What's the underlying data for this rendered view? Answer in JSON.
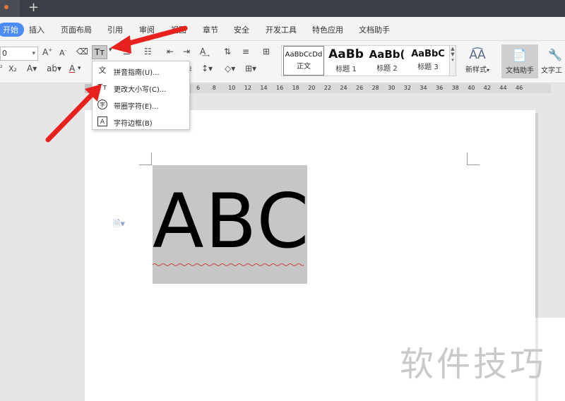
{
  "tabbar": {
    "new_tab_icon": "plus-icon",
    "new_tab_label": "+"
  },
  "menu": {
    "items": [
      "开始",
      "插入",
      "页面布局",
      "引用",
      "审阅",
      "视图",
      "章节",
      "安全",
      "开发工具",
      "特色应用",
      "文档助手"
    ],
    "active_index": 0,
    "active_color": "#4c8cf5"
  },
  "ribbon": {
    "font_size_value": "0",
    "icons": [
      "increase-font-icon",
      "decrease-font-icon",
      "clear-format-icon",
      "change-case-icon",
      "bullet-list-icon",
      "numbered-list-icon",
      "indent-icon",
      "outdent-icon",
      "text-direction-icon",
      "sort-icon",
      "line-spacing-icon",
      "table-icon",
      "superscript-icon",
      "subscript-icon",
      "font-color-icon",
      "highlight-icon",
      "shading-icon",
      "border-icon"
    ],
    "styles": [
      {
        "sample": "AaBbCcDd",
        "name": "正文"
      },
      {
        "sample": "AaBb",
        "name": "标题 1"
      },
      {
        "sample": "AaBb(",
        "name": "标题 2"
      },
      {
        "sample": "AaBbC",
        "name": "标题 3"
      }
    ],
    "new_style_label": "新样式",
    "doc_assistant_label": "文档助手",
    "text_tools_label": "文字工"
  },
  "ruler": {
    "numbers": [
      "6",
      "8",
      "10",
      "12",
      "14",
      "16",
      "18",
      "20",
      "22",
      "24",
      "26",
      "28",
      "30",
      "32",
      "34",
      "36",
      "38",
      "40",
      "42",
      "44",
      "46"
    ]
  },
  "document": {
    "text": "ABC"
  },
  "dropdown": {
    "items": [
      {
        "icon": "pinyin-guide-icon",
        "glyph": "文",
        "label": "拼音指南(U)..."
      },
      {
        "icon": "change-case-icon",
        "glyph": "Tт",
        "label": "更改大小写(C)..."
      },
      {
        "icon": "enclosed-character-icon",
        "glyph": "字",
        "label": "带圈字符(E)..."
      },
      {
        "icon": "character-border-icon",
        "glyph": "A",
        "label": "字符边框(B)"
      }
    ]
  },
  "watermark": {
    "text": "软件技巧"
  },
  "annotation_color": "#e8211e"
}
